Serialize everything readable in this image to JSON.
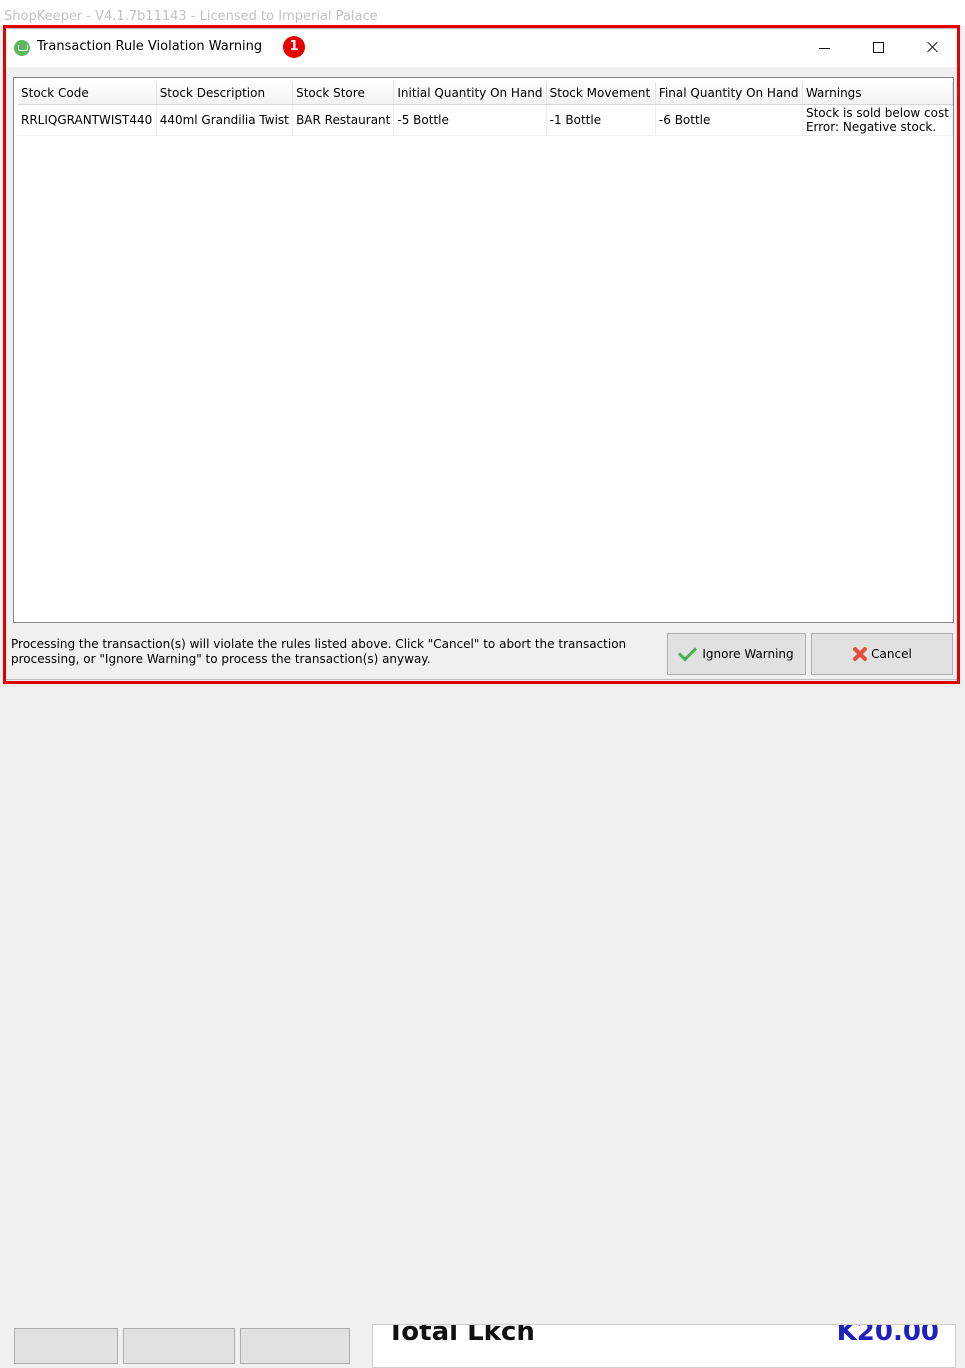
{
  "background_window": {
    "title": "ShopKeeper - V4.1.7b11143 - Licensed to Imperial Palace",
    "total_label": "Total Lkch",
    "total_amount": "K20.00"
  },
  "dialog": {
    "title": "Transaction Rule Violation Warning",
    "annotation_badge": "1",
    "columns": [
      "Stock Code",
      "Stock Description",
      "Stock Store",
      "Initial Quantity On Hand",
      "Stock Movement",
      "Final Quantity On Hand",
      "Warnings"
    ],
    "rows": [
      {
        "stock_code": "RRLIQGRANTWIST440",
        "stock_description": "440ml Grandilia Twist",
        "stock_store": "BAR Restaurant",
        "initial_quantity": "-5 Bottle",
        "stock_movement": "-1 Bottle",
        "final_quantity": "-6 Bottle",
        "warnings": [
          "Stock is sold below cost",
          "Error: Negative stock."
        ]
      }
    ],
    "footer_message": "Processing the transaction(s) will violate the rules listed above. Click \"Cancel\" to abort the transaction processing, or \"Ignore Warning\" to process the transaction(s) anyway.",
    "ignore_button_label": "Ignore Warning",
    "cancel_button_label": "Cancel"
  },
  "colors": {
    "highlight": "#e30000",
    "accent_green": "#4caf50",
    "cancel_red": "#e74c3c"
  }
}
